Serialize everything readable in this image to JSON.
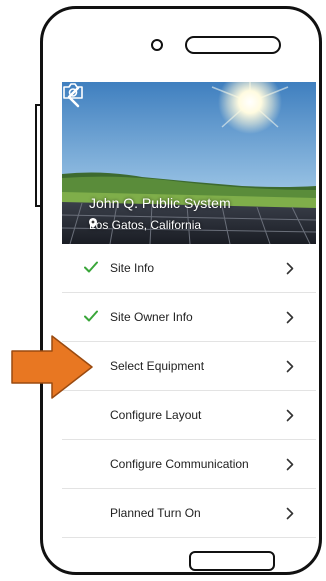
{
  "site": {
    "system_name": "John Q. Public System",
    "location": "Los Gatos, California"
  },
  "menu": {
    "items": [
      {
        "label": "Site Info",
        "completed": true
      },
      {
        "label": "Site Owner Info",
        "completed": true
      },
      {
        "label": "Select Equipment",
        "completed": false
      },
      {
        "label": "Configure Layout",
        "completed": false
      },
      {
        "label": "Configure Communication",
        "completed": false
      },
      {
        "label": "Planned Turn On",
        "completed": false
      }
    ]
  },
  "colors": {
    "check": "#3aa63a",
    "pointer_arrow": "#e87722",
    "chevron": "#333333"
  },
  "icons": {
    "back": "chevron-left-icon",
    "location": "location-pin-icon",
    "camera": "camera-icon",
    "completed": "check-icon",
    "disclosure": "chevron-right-icon"
  }
}
